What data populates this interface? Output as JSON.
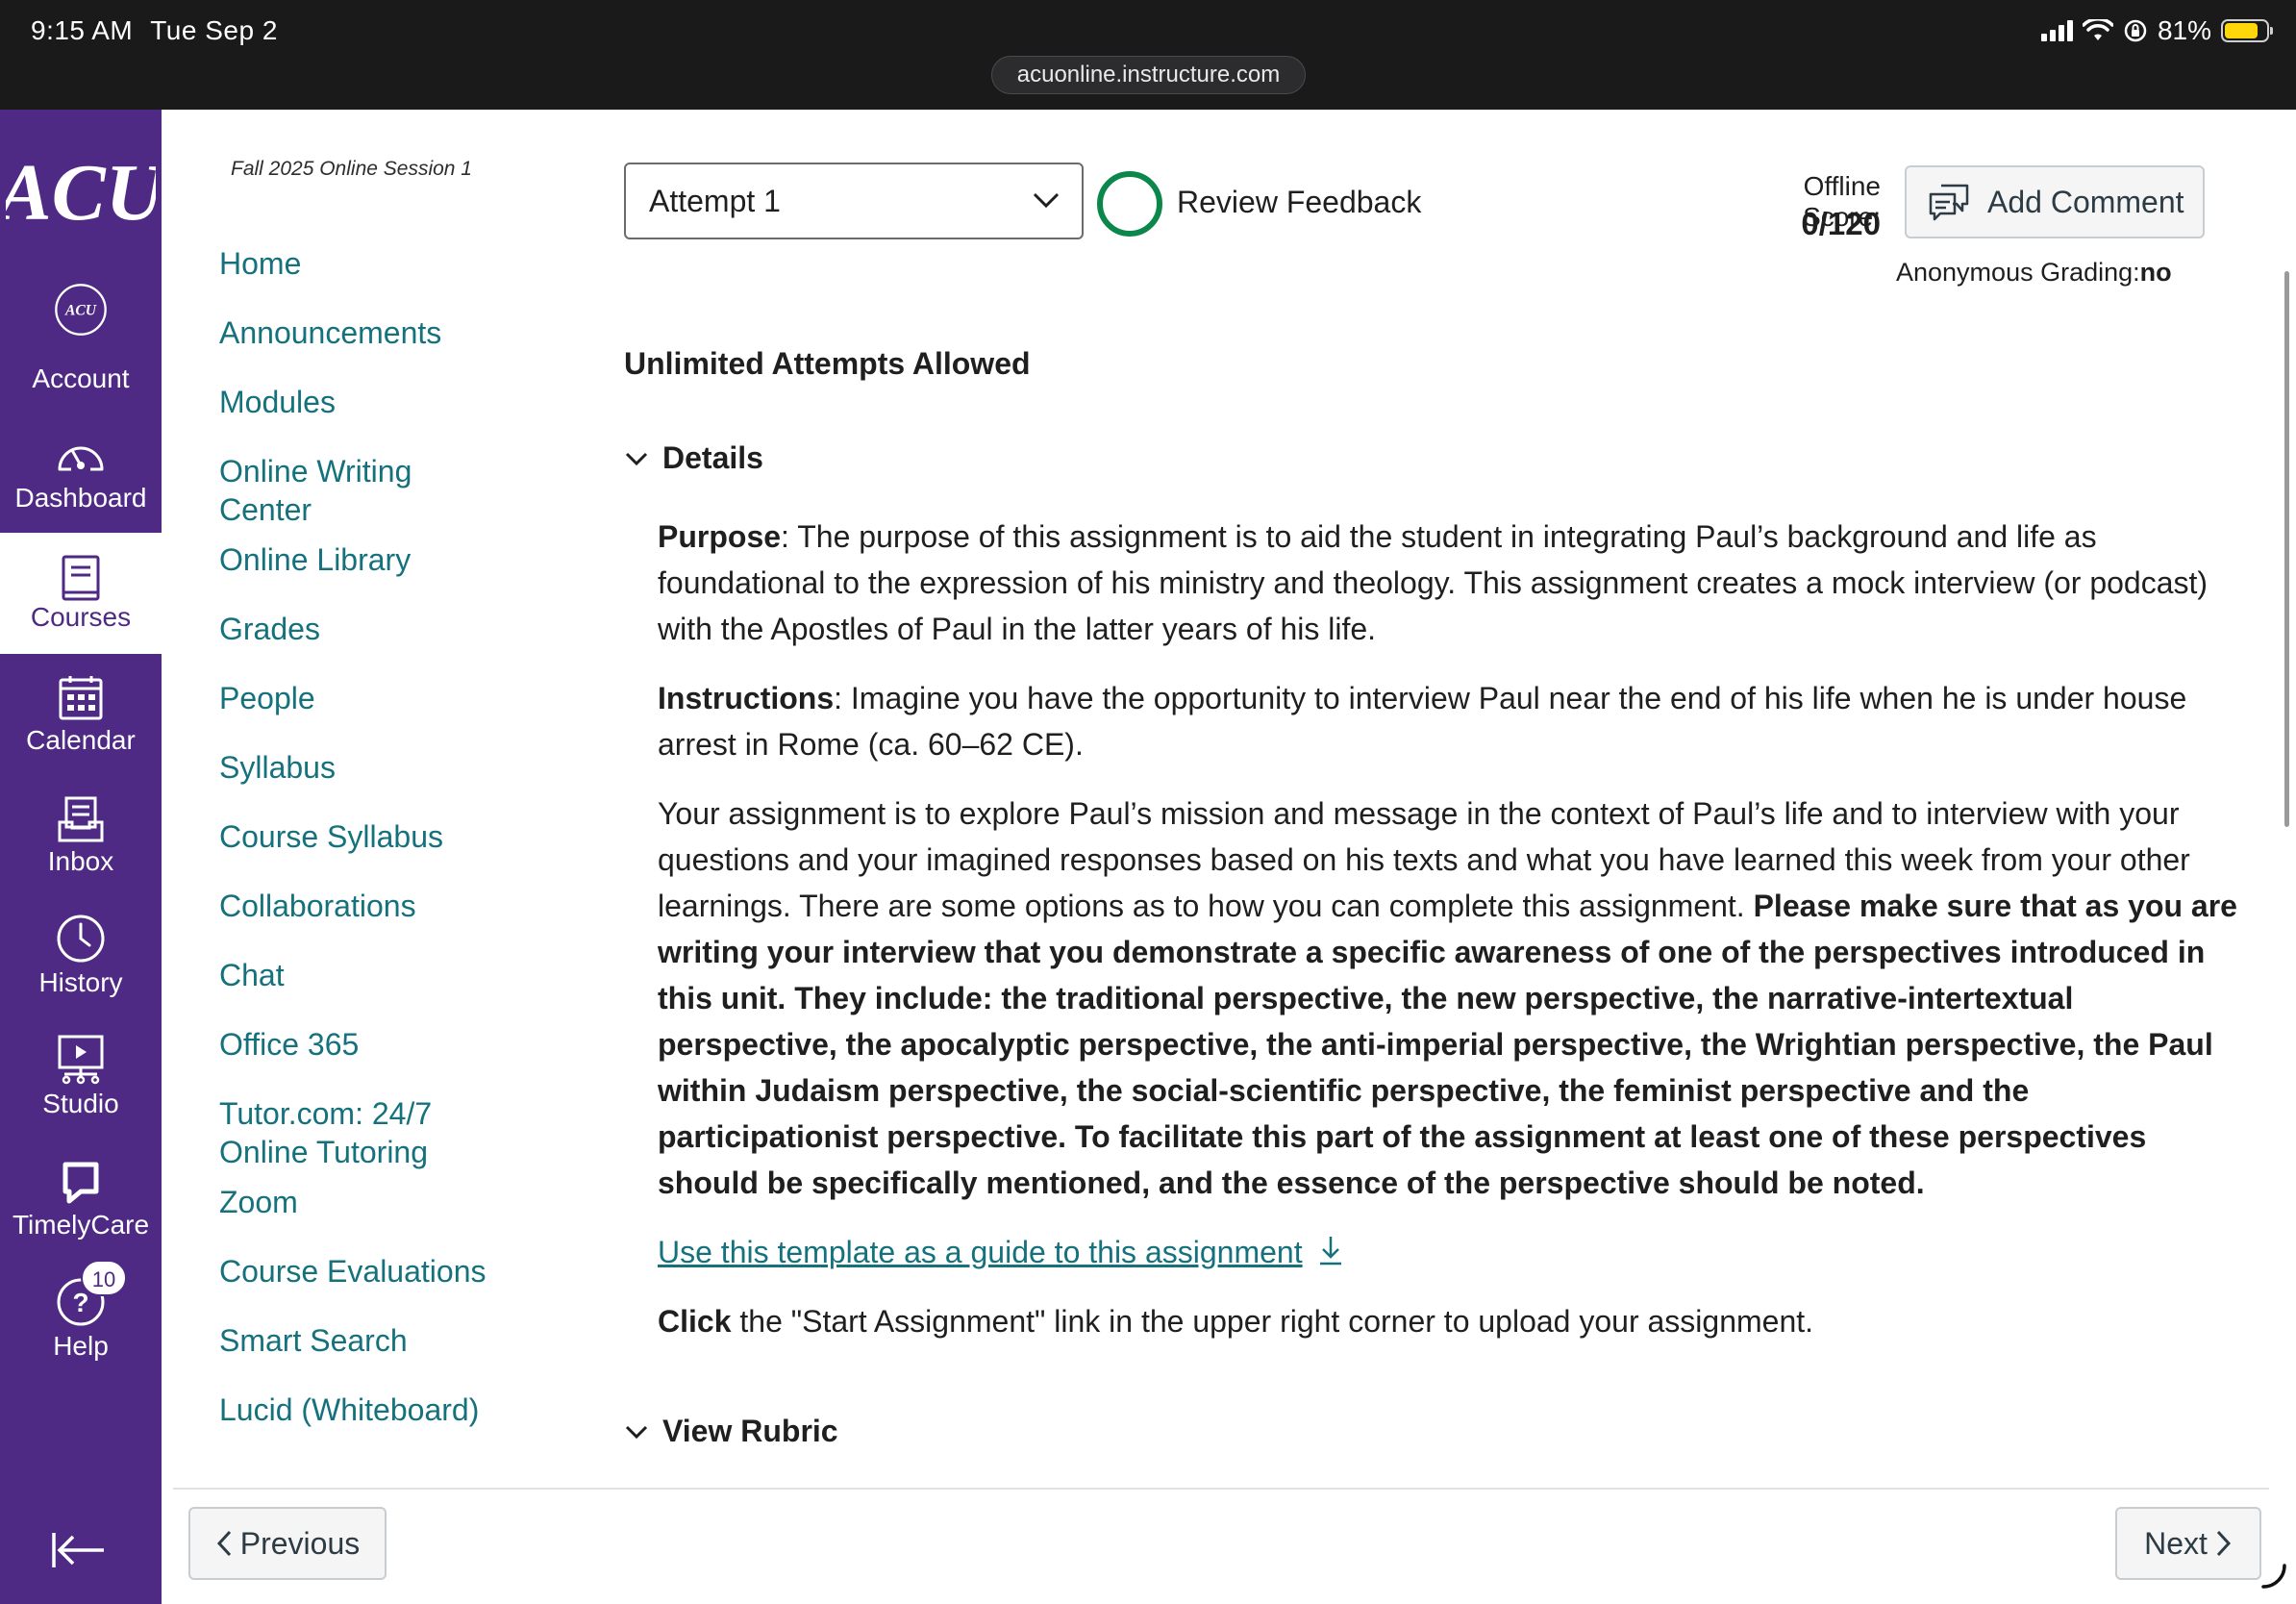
{
  "status_bar": {
    "time": "9:15 AM",
    "date": "Tue Sep 2",
    "url": "acuonline.instructure.com",
    "battery": "81%",
    "battery_level": 0.81
  },
  "global_nav": {
    "logo_text": "ACU",
    "items": [
      {
        "label": "Account",
        "icon": "account-avatar-icon"
      },
      {
        "label": "Dashboard",
        "icon": "dashboard-gauge-icon"
      },
      {
        "label": "Courses",
        "icon": "courses-book-icon",
        "active": true
      },
      {
        "label": "Calendar",
        "icon": "calendar-icon"
      },
      {
        "label": "Inbox",
        "icon": "inbox-icon"
      },
      {
        "label": "History",
        "icon": "history-clock-icon"
      },
      {
        "label": "Studio",
        "icon": "studio-icon"
      },
      {
        "label": "TimelyCare",
        "icon": "timelycare-icon"
      },
      {
        "label": "Help",
        "icon": "help-icon",
        "badge": "10"
      }
    ]
  },
  "course_nav": {
    "term": "Fall 2025 Online Session 1",
    "links": [
      {
        "label": "Home"
      },
      {
        "label": "Announcements"
      },
      {
        "label": "Modules"
      },
      {
        "label": "Online Writing",
        "label2": "Center"
      },
      {
        "label": "Online Library"
      },
      {
        "label": "Grades"
      },
      {
        "label": "People"
      },
      {
        "label": "Syllabus"
      },
      {
        "label": "Course Syllabus"
      },
      {
        "label": "Collaborations"
      },
      {
        "label": "Chat"
      },
      {
        "label": "Office 365"
      },
      {
        "label": "Tutor.com: 24/7",
        "label2": "Online Tutoring"
      },
      {
        "label": "Zoom"
      },
      {
        "label": "Course Evaluations"
      },
      {
        "label": "Smart Search"
      },
      {
        "label": "Lucid (Whiteboard)"
      }
    ]
  },
  "submission": {
    "attempt": "Attempt 1",
    "review_feedback": "Review Feedback",
    "offline_score_label": "Offline Score:",
    "offline_score": "0/120",
    "add_comment": "Add Comment",
    "anon_label": "Anonymous Grading:",
    "anon_value": "no",
    "attempts_allowed": "Unlimited Attempts Allowed"
  },
  "details": {
    "heading": "Details",
    "purpose_label": "Purpose",
    "purpose_text": ": The purpose of this assignment is to aid the student in integrating Paul’s background and life as foundational to the expression of his ministry and theology. This assignment creates a mock interview (or podcast) with the Apostles of Paul in the latter years of his life.",
    "instructions_label": "Instructions",
    "instructions_text": ": Imagine you have the opportunity to interview Paul near the end of his life when he is under house arrest in Rome (ca. 60–62 CE).",
    "para3_text": "Your assignment is to explore Paul’s mission and message in the context of Paul’s life and to interview with your questions and your imagined responses based on his texts and what you have learned this week from your other learnings. There are some options as to how you can complete this assignment. ",
    "para3_bold": "Please make sure that as you are writing your interview that you demonstrate a specific awareness of one of the perspectives introduced in this unit. They include: the traditional perspective, the new perspective, the narrative-intertextual perspective, the apocalyptic perspective, the anti-imperial perspective, the Wrightian perspective, the Paul within Judaism perspective, the social-scientific perspective, the feminist perspective and the participationist perspective. To facilitate this part of the assignment at least one of these perspectives should be specifically mentioned, and the essence of the perspective should be noted.",
    "template_link": "Use this template as a guide to this assignment",
    "click_label": "Click",
    "click_text": " the \"Start Assignment\" link in the upper right corner to upload your assignment."
  },
  "rubric": {
    "heading": "View Rubric"
  },
  "footer": {
    "previous": "Previous",
    "next": "Next"
  },
  "colors": {
    "nav_purple": "#4e2a84",
    "link_teal": "#15727d",
    "feedback_green": "#0b874b"
  }
}
